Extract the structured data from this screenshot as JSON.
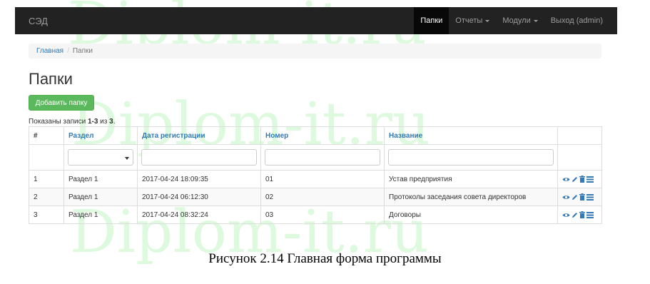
{
  "navbar": {
    "brand": "СЭД",
    "items": [
      {
        "label": "Папки",
        "active": true,
        "dropdown": false
      },
      {
        "label": "Отчеты",
        "active": false,
        "dropdown": true
      },
      {
        "label": "Модули",
        "active": false,
        "dropdown": true
      },
      {
        "label": "Выход (admin)",
        "active": false,
        "dropdown": false
      }
    ]
  },
  "breadcrumb": {
    "home": "Главная",
    "current": "Папки"
  },
  "page": {
    "title": "Папки",
    "add_button": "Добавить папку"
  },
  "summary": {
    "prefix": "Показаны записи ",
    "range": "1-3",
    "middle": " из ",
    "total": "3",
    "suffix": "."
  },
  "table": {
    "headers": [
      "#",
      "Раздел",
      "Дата регистрации",
      "Номер",
      "Название"
    ],
    "rows": [
      {
        "num": "1",
        "section": "Раздел 1",
        "date": "2017-04-24 18:09:35",
        "number": "01",
        "title": "Устав предприятия"
      },
      {
        "num": "2",
        "section": "Раздел 1",
        "date": "2017-04-24 06:12:30",
        "number": "02",
        "title": "Протоколы заседания совета директоров"
      },
      {
        "num": "3",
        "section": "Раздел 1",
        "date": "2017-04-24 08:32:24",
        "number": "03",
        "title": "Договоры"
      }
    ]
  },
  "caption": "Рисунок 2.14 Главная форма программы",
  "watermark": "Diplom-it.ru",
  "colors": {
    "navbar": "#222222",
    "link": "#337ab7",
    "success": "#5cb85c",
    "watermark": "#00dc00"
  }
}
